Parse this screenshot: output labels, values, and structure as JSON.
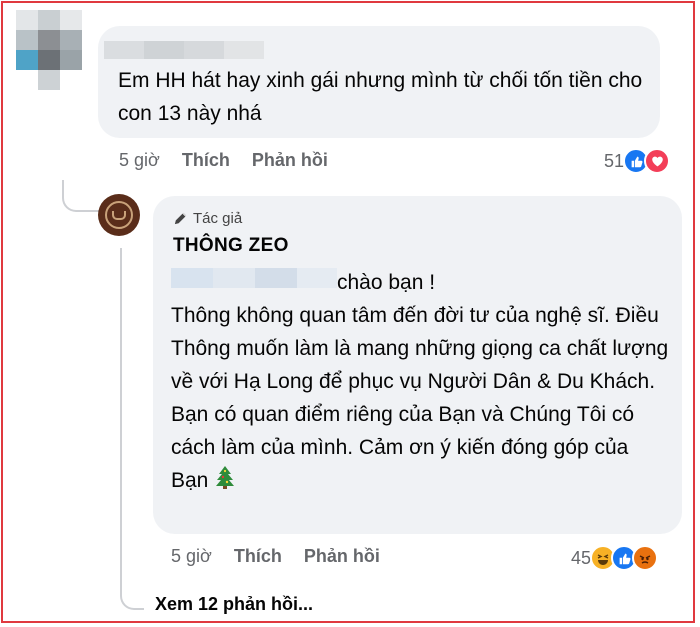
{
  "comment1": {
    "text": "Em HH hát hay xinh gái nhưng mình từ chối tốn tiền cho con 13 này nhá",
    "time": "5 giờ",
    "like_label": "Thích",
    "reply_label": "Phản hồi",
    "reaction_count": "51",
    "reactions": [
      "like-icon",
      "love-icon"
    ]
  },
  "reply": {
    "badge": "Tác giả",
    "author": "THÔNG ZEO",
    "mention_suffix": "chào bạn !",
    "text": "Thông không quan tâm đến đời tư của nghệ sĩ. Điều Thông muốn làm là mang những giọng ca chất lượng về với Hạ Long để phục vụ Người Dân & Du Khách. Bạn có quan điểm riêng của Bạn và Chúng Tôi có cách làm của mình. Cảm ơn ý kiến đóng góp của Bạn",
    "time": "5 giờ",
    "like_label": "Thích",
    "reply_label": "Phản hồi",
    "reaction_count": "45",
    "reactions": [
      "haha-icon",
      "like-icon",
      "angry-icon"
    ]
  },
  "view_more": "Xem 12 phản hồi...",
  "colors": {
    "frame": "#e0393f",
    "bubble": "#f0f2f5",
    "muted": "#65676b",
    "like": "#1877f2",
    "love": "#f33e58"
  }
}
